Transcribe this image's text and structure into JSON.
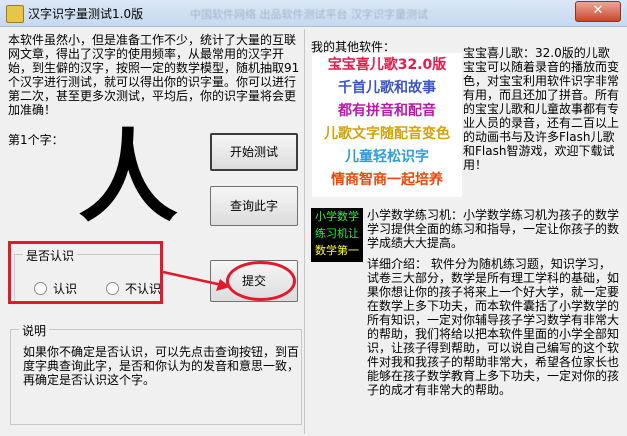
{
  "window": {
    "title": "汉字识字量测试1.0版",
    "blurred_caption": "中国软件网络 出品软件测试平台 汉字识字量测试",
    "close_glyph": "✕",
    "icon": "app-icon"
  },
  "intro": "本软件虽然小，但是准备工作不少，统计了大量的互联网文章，得出了汉字的使用频率，从最常用的汉字开始，到生僻的汉字，按照一定的数学模型，随机抽取91个汉字进行测试，就可以得出你的识字量。你可以进行第二次，甚至更多次测试，平均后，你的识字量将会更加准确！",
  "test": {
    "char_label": "第1个字：",
    "character": "人",
    "start_button": "开始测试",
    "lookup_button": "查询此字",
    "submit_button": "提交"
  },
  "recognize": {
    "title": "是否认识",
    "yes": "认识",
    "no": "不认识"
  },
  "note": {
    "title": "说明",
    "text": "如果你不确定是否认识，可以先点击查询按钮，到百度字典查询此字，是否和你认为的发音和意思一致，再确定是否认识这个字。"
  },
  "other_software": {
    "title": "我的其他软件："
  },
  "ad": {
    "lines": [
      {
        "text": "宝宝喜儿歌32.0版",
        "color": "#e8194b"
      },
      {
        "text": "千首儿歌和故事",
        "color": "#3b55c8"
      },
      {
        "text": "都有拼音和配音",
        "color": "#b81aa8"
      },
      {
        "text": "儿歌文字随配音变色",
        "color": "#d1a409"
      },
      {
        "text": "儿童轻松识字",
        "color": "#2e9cd8"
      },
      {
        "text": "情商智商一起培养",
        "color": "#e34b12"
      }
    ],
    "desc": "宝宝喜儿歌：32.0版的儿歌宝宝可以随着录音的播放而变色，对宝宝利用软件识字非常有用，而且还加了拼音。所有的宝宝儿歌和儿童故事都有专业人员的录音，还有二百以上的动画书与及许多Flash儿歌和Flash智游戏，欢迎下载试用！"
  },
  "math_app": {
    "icon_lines": [
      {
        "text": "小学数学",
        "color": "#33ee33"
      },
      {
        "text": "练习机让",
        "color": "#33ee33"
      },
      {
        "text": "数学第一",
        "color": "#ffff33"
      }
    ],
    "title": "小学数学练习机：小学数学练习机为孩子的数学学习提供全面的练习和指导，一定让你孩子的数学成绩大大提高。",
    "desc": "详细介绍： 软件分为随机练习题，知识学习，试卷三大部分，数学是所有理工学科的基础，如果你想让你的孩子将来上一个好大学，就一定要在数学上多下功夫，而本软件囊括了小学数学的所有知识，一定对你辅导孩子学习数学有非常大的帮助，我们将给以把本软件里面的小学全部知识，让孩子得到帮助，可以说自己编写的这个软件对我和我孩子的帮助非常大，希望各位家长也能够在孩子数学教育上多下功夫，一定对你的孩子的成才有非常大的帮助。"
  }
}
